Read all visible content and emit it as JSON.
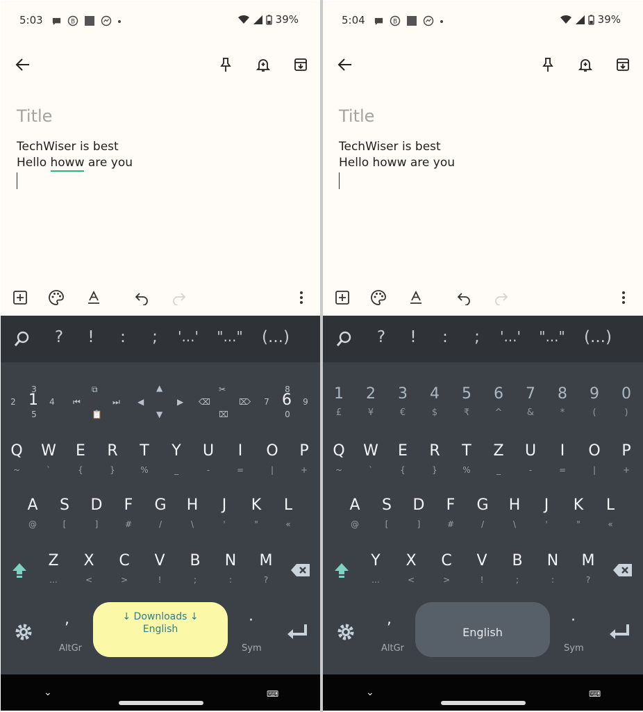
{
  "left": {
    "status": {
      "time": "5:03",
      "battery": "39%"
    },
    "note": {
      "title_placeholder": "Title",
      "line1": "TechWiser is best",
      "line2_before": "Hello ",
      "line2_word": "howw",
      "line2_after": " are you"
    },
    "suggestions": [
      "?",
      "!",
      ":",
      ";",
      "'...'",
      "\"...\"",
      "(...)"
    ],
    "nav_row": {
      "left_digits": {
        "top": "3",
        "main": "1",
        "bottom": "5",
        "l": "2",
        "r": "4"
      },
      "right_digits": {
        "top": "8",
        "main": "6",
        "bottom": "0",
        "l": "7",
        "r": "9"
      }
    },
    "space": {
      "line1": "↓ Downloads ↓",
      "line2": "English"
    },
    "row1": [
      {
        "k": "Q",
        "h": "~"
      },
      {
        "k": "W",
        "h": "`"
      },
      {
        "k": "E",
        "h": "{"
      },
      {
        "k": "R",
        "h": "}"
      },
      {
        "k": "T",
        "h": "%"
      },
      {
        "k": "Y",
        "h": "_"
      },
      {
        "k": "U",
        "h": "-"
      },
      {
        "k": "I",
        "h": "="
      },
      {
        "k": "O",
        "h": "|"
      },
      {
        "k": "P",
        "h": "+"
      }
    ],
    "row2": [
      {
        "k": "A",
        "h": "@"
      },
      {
        "k": "S",
        "h": "["
      },
      {
        "k": "D",
        "h": "]"
      },
      {
        "k": "F",
        "h": "#"
      },
      {
        "k": "G",
        "h": "/"
      },
      {
        "k": "H",
        "h": "\\"
      },
      {
        "k": "J",
        "h": "'"
      },
      {
        "k": "K",
        "h": "\""
      },
      {
        "k": "L",
        "h": "«"
      }
    ],
    "row3": [
      {
        "k": "Z",
        "h": "…"
      },
      {
        "k": "X",
        "h": "<"
      },
      {
        "k": "C",
        "h": ">"
      },
      {
        "k": "V",
        "h": "!"
      },
      {
        "k": "B",
        "h": ";"
      },
      {
        "k": "N",
        "h": ":"
      },
      {
        "k": "M",
        "h": "?"
      }
    ],
    "comma_label": "AltGr",
    "period_label": "Sym"
  },
  "right": {
    "status": {
      "time": "5:04",
      "battery": "39%"
    },
    "note": {
      "title_placeholder": "Title",
      "line1": "TechWiser is best",
      "line2": "Hello howw are you"
    },
    "suggestions": [
      "?",
      "!",
      ":",
      ";",
      "'...'",
      "\"...\"",
      "(...)"
    ],
    "numbers": [
      {
        "k": "1",
        "h": "£"
      },
      {
        "k": "2",
        "h": "¥"
      },
      {
        "k": "3",
        "h": "€"
      },
      {
        "k": "4",
        "h": "$"
      },
      {
        "k": "5",
        "h": "₹"
      },
      {
        "k": "6",
        "h": "^"
      },
      {
        "k": "7",
        "h": "&"
      },
      {
        "k": "8",
        "h": "*"
      },
      {
        "k": "9",
        "h": "("
      },
      {
        "k": "0",
        "h": ")"
      }
    ],
    "space": {
      "line2": "English"
    },
    "row1": [
      {
        "k": "Q",
        "h": "~"
      },
      {
        "k": "W",
        "h": "`"
      },
      {
        "k": "E",
        "h": "{"
      },
      {
        "k": "R",
        "h": "}"
      },
      {
        "k": "T",
        "h": "%"
      },
      {
        "k": "Z",
        "h": "_"
      },
      {
        "k": "U",
        "h": "-"
      },
      {
        "k": "I",
        "h": "="
      },
      {
        "k": "O",
        "h": "|"
      },
      {
        "k": "P",
        "h": "+"
      }
    ],
    "row2": [
      {
        "k": "A",
        "h": "@"
      },
      {
        "k": "S",
        "h": "["
      },
      {
        "k": "D",
        "h": "]"
      },
      {
        "k": "F",
        "h": "#"
      },
      {
        "k": "G",
        "h": "/"
      },
      {
        "k": "H",
        "h": "\\"
      },
      {
        "k": "J",
        "h": "'"
      },
      {
        "k": "K",
        "h": "\""
      },
      {
        "k": "L",
        "h": "«"
      }
    ],
    "row3": [
      {
        "k": "Y",
        "h": "…"
      },
      {
        "k": "X",
        "h": "<"
      },
      {
        "k": "C",
        "h": ">"
      },
      {
        "k": "V",
        "h": "!"
      },
      {
        "k": "B",
        "h": ";"
      },
      {
        "k": "N",
        "h": ":"
      },
      {
        "k": "M",
        "h": "?"
      }
    ],
    "comma_label": "AltGr",
    "period_label": "Sym"
  },
  "colors": {
    "shift_accent": "#7fd1c3",
    "space_yellow": "#fbf8a8",
    "space_dark": "#576068",
    "keyboard_bg": "#3c4148",
    "suggest_bg": "#2f3337"
  }
}
